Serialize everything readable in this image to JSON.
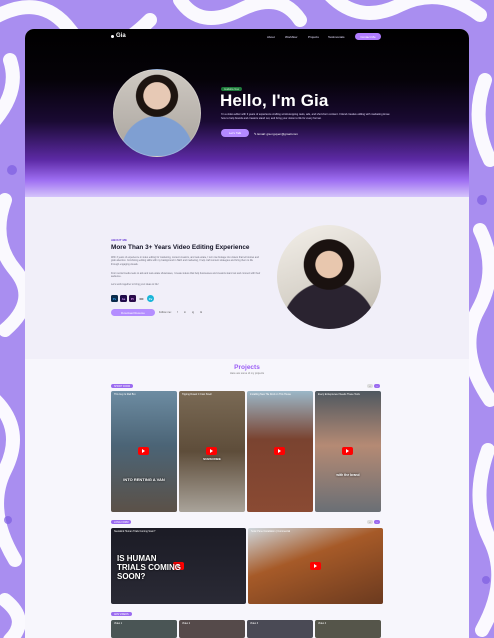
{
  "nav": {
    "logo": "Gia",
    "links": [
      "About",
      "Workflow",
      "Projects",
      "Testimonials"
    ],
    "cta": "Contact Me"
  },
  "hero": {
    "badge": "Available Now",
    "title": "Hello, I'm Gia",
    "description": "I'm a video editor with 3 years of experience crafting scroll-stopping reels, ads, and short-form content. I blend creative editing with marketing know-how to help brands and creators stand out, and bring your vision to life for every format.",
    "button": "Let's Talk",
    "email": "Email: gia.nguyen@gmail.com"
  },
  "about": {
    "eyebrow": "ABOUT ME",
    "title": "More Than 3+ Years Video Editing Experience",
    "paragraphs": [
      "With 3 years of experience in video editing for marketing, content creators, and real estate, I turn raw footage into videos that tell stories and grab attention. Combining editing skills with my background in SEO and marketing, I help craft content strategies and bring them to life through engaging visuals.",
      "From social media reels to ads and real estate showcases, I create videos that help businesses and creators stand out and connect with their audience.",
      "Let's work together to bring your ideas to life!"
    ],
    "tools": [
      {
        "label": "Ps",
        "color": "#0b2a4a"
      },
      {
        "label": "Ae",
        "color": "#1f0b4a"
      },
      {
        "label": "Pr",
        "color": "#2a0b4a"
      },
      {
        "label": "CC",
        "color": "#111111"
      },
      {
        "label": "Cv",
        "color": "#19b5d8"
      }
    ],
    "resume_button": "Download Resume",
    "follow_label": "Follow me:",
    "socials": [
      "f",
      "in",
      "ig",
      "tk"
    ]
  },
  "projects": {
    "title": "Projects",
    "subtitle": "Here are some of my projects",
    "categories": [
      {
        "label": "SHORT FORM",
        "videos": [
          {
            "title": "This Guy Is Rad Bro",
            "caption": "",
            "bg": "#3e5a6b"
          },
          {
            "title": "Tipping Dowel C Cost Smell",
            "caption": "",
            "bg": "#6f5a3f"
          },
          {
            "title": "Installing New Tile Roof on This House",
            "caption": "",
            "bg": "#7b3f2c"
          },
          {
            "title": "Every Entrepreneur Needs These Tools",
            "caption": "with the brand",
            "bg": "#566068"
          }
        ]
      },
      {
        "label": "LONG FORM",
        "videos": [
          {
            "title": "Neuralink Human Trials Coming Soon?",
            "caption": "IS HUMAN TRIALS COMING SOON?",
            "bg": "#222230"
          },
          {
            "title": "Solar Panel Installation | Commercial",
            "caption": "",
            "bg": "#8a4a22"
          }
        ]
      },
      {
        "label": "ADS VIDEOS",
        "videos": [
          {
            "title": "Video 1",
            "caption": "",
            "bg": "#455"
          },
          {
            "title": "Video 2",
            "caption": "",
            "bg": "#544"
          },
          {
            "title": "Video 3",
            "caption": "",
            "bg": "#445"
          },
          {
            "title": "Video 4",
            "caption": "",
            "bg": "#554"
          }
        ]
      }
    ],
    "video_overlays": {
      "short_1": "INTO RENTING A VAN",
      "short_2": "SUBSCRIBE"
    }
  }
}
